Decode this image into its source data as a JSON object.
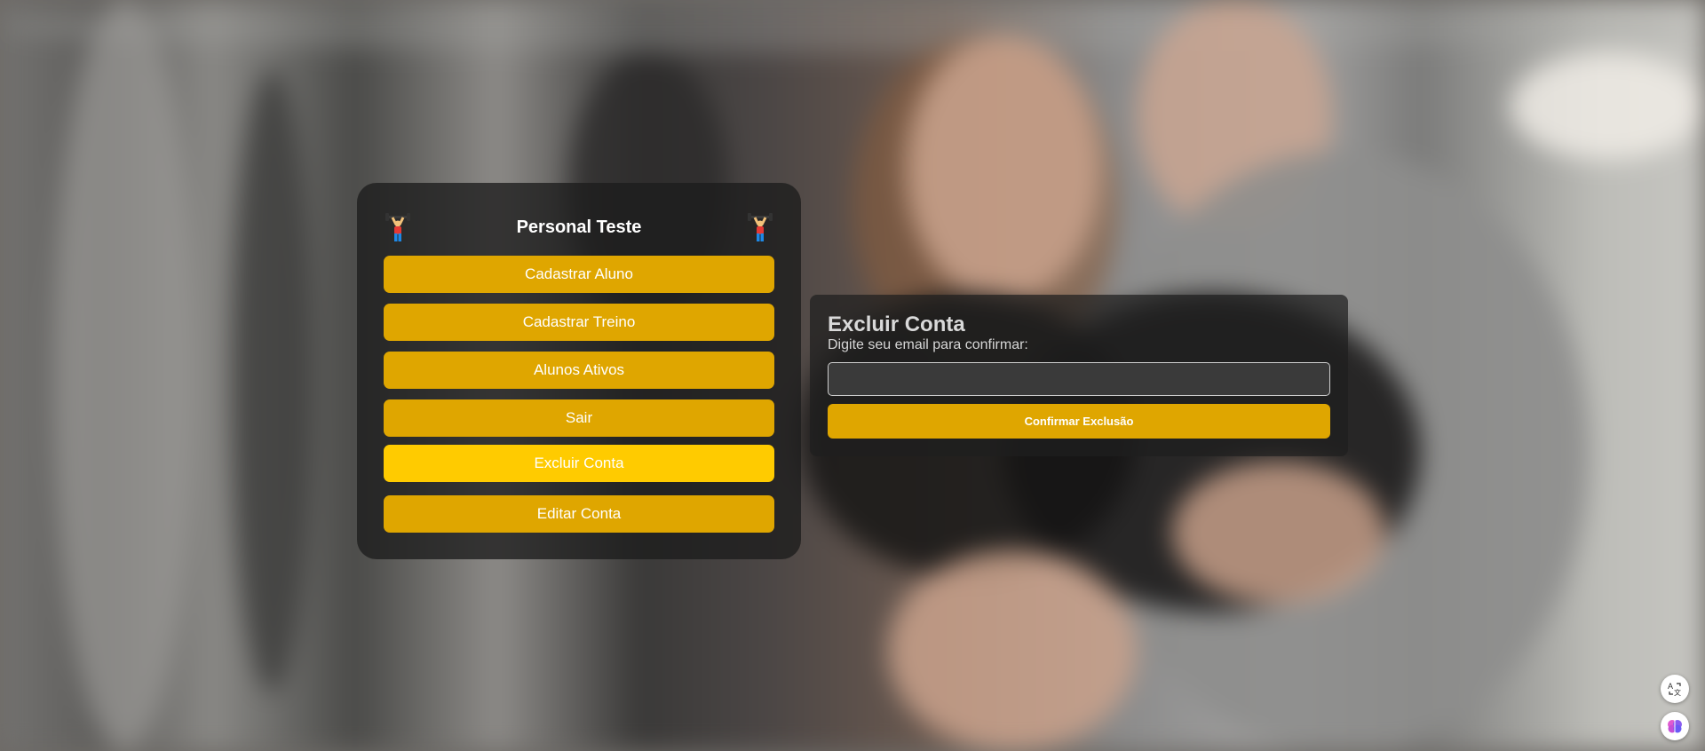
{
  "menu": {
    "title": "Personal Teste",
    "items": [
      {
        "label": "Cadastrar Aluno",
        "active": false
      },
      {
        "label": "Cadastrar Treino",
        "active": false
      },
      {
        "label": "Alunos Ativos",
        "active": false
      },
      {
        "label": "Sair",
        "active": false
      },
      {
        "label": "Excluir Conta",
        "active": true
      },
      {
        "label": "Editar Conta",
        "active": false
      }
    ],
    "logo_icon": "weightlifter-icon"
  },
  "delete_account": {
    "title": "Excluir Conta",
    "label": "Digite seu email para confirmar:",
    "email_value": "",
    "confirm_label": "Confirmar Exclusão"
  },
  "widgets": [
    {
      "icon": "translate-icon"
    },
    {
      "icon": "brain-icon"
    }
  ],
  "colors": {
    "button": "#dfa600",
    "button_active": "#ffcb00",
    "panel": "rgba(28,28,28,0.78)",
    "text": "#ffffff"
  }
}
